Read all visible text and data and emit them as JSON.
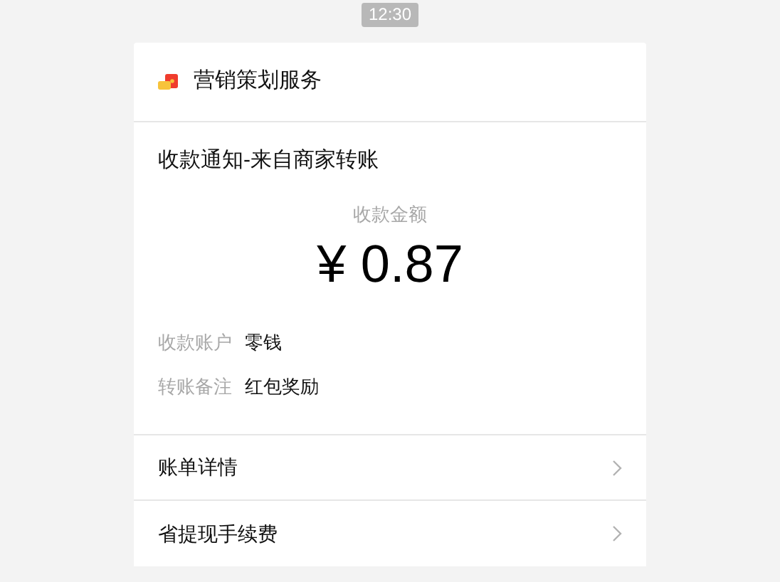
{
  "timestamp": "12:30",
  "card": {
    "service_name": "营销策划服务",
    "title": "收款通知-来自商家转账",
    "amount_label": "收款金额",
    "amount": "¥ 0.87",
    "details": [
      {
        "label": "收款账户",
        "value": "零钱"
      },
      {
        "label": "转账备注",
        "value": "红包奖励"
      }
    ],
    "links": [
      {
        "label": "账单详情"
      },
      {
        "label": "省提现手续费"
      }
    ]
  }
}
